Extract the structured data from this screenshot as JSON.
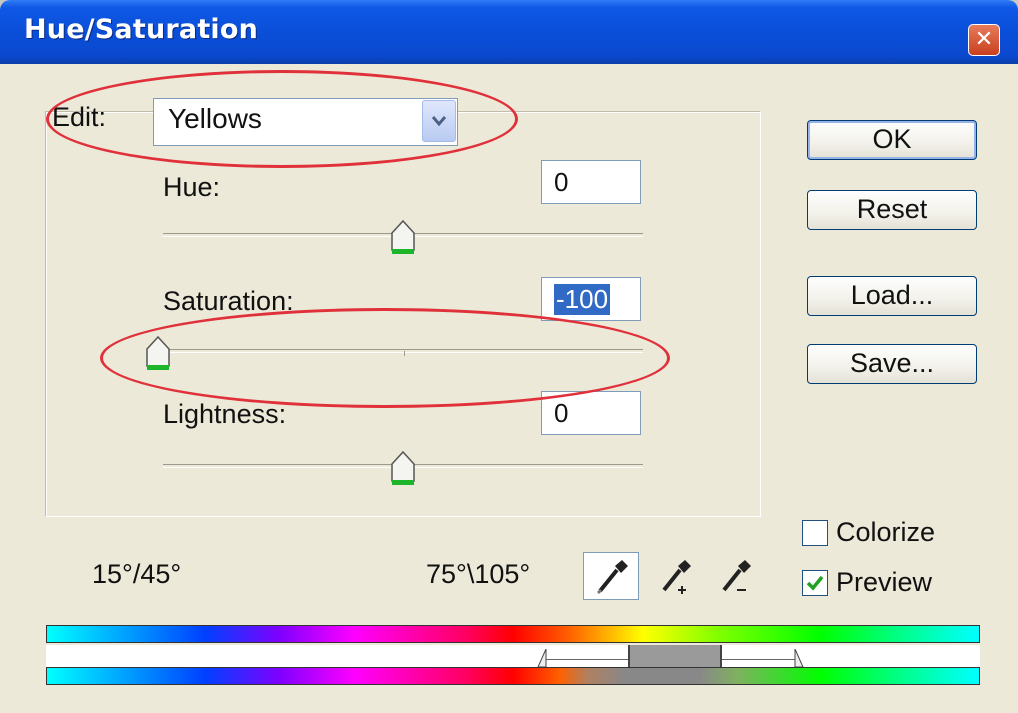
{
  "window": {
    "title": "Hue/Saturation"
  },
  "edit": {
    "label": "Edit:",
    "value": "Yellows"
  },
  "hue": {
    "label": "Hue:",
    "value": "0"
  },
  "saturation": {
    "label": "Saturation:",
    "value": "-100"
  },
  "lightness": {
    "label": "Lightness:",
    "value": "0"
  },
  "buttons": {
    "ok": "OK",
    "reset": "Reset",
    "load": "Load...",
    "save": "Save..."
  },
  "options": {
    "colorize": "Colorize",
    "preview": "Preview",
    "colorize_checked": false,
    "preview_checked": true
  },
  "range": {
    "left": "15°/45°",
    "right": "75°\\105°"
  },
  "colors": {
    "accent": "#0a4fd9",
    "selection": "#316ac5",
    "annotation": "#e0303a"
  }
}
